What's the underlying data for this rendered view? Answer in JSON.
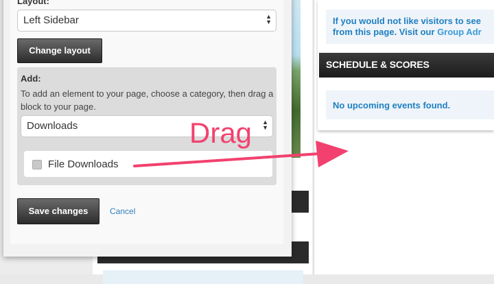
{
  "sidebar_panel": {
    "layout_label": "Layout:",
    "layout_select_value": "Left Sidebar",
    "change_layout_label": "Change layout",
    "add_title": "Add:",
    "add_description": "To add an element to your page, choose a category, then drag a block to your page.",
    "category_select_value": "Downloads",
    "block_label": "File Downloads",
    "block_icon": "file-icon",
    "save_label": "Save changes",
    "cancel_label": "Cancel"
  },
  "annotation": {
    "drag_text": "Drag",
    "color": "#f2416e"
  },
  "right_column": {
    "notice_line1": "If you would not like visitors to see",
    "notice_line2_text": "from this page. Visit our ",
    "notice_link": "Group Adr",
    "schedule_header": "SCHEDULE & SCORES",
    "no_events": "No upcoming events found."
  },
  "colors": {
    "link": "#1f7fc1",
    "panel_bg": "#eef4f9",
    "header_dark": "#2b2b2b"
  }
}
